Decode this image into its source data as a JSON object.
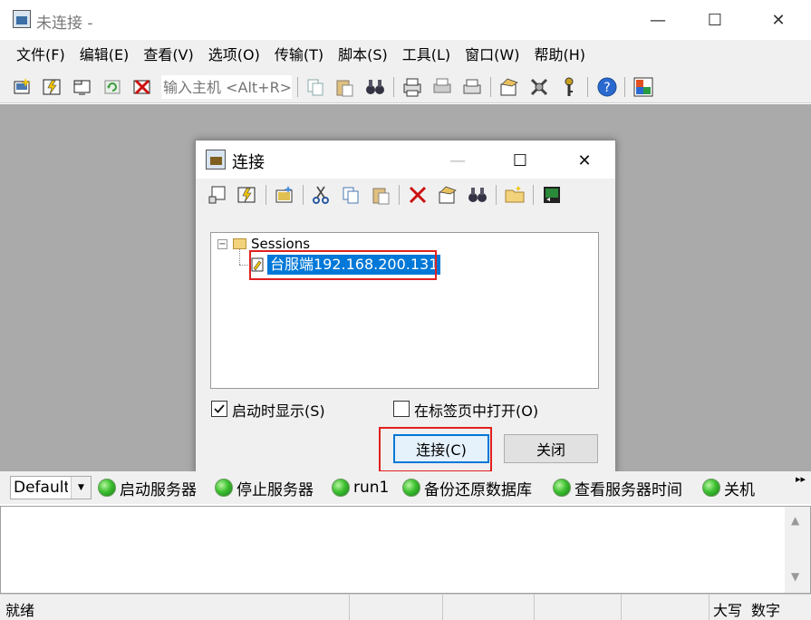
{
  "window": {
    "title": "未连接 -",
    "minimize": "—",
    "maximize": "☐",
    "close": "✕"
  },
  "menu": {
    "items": [
      "文件(F)",
      "编辑(E)",
      "查看(V)",
      "选项(O)",
      "传输(T)",
      "脚本(S)",
      "工具(L)",
      "窗口(W)",
      "帮助(H)"
    ]
  },
  "toolbar": {
    "host_placeholder": "输入主机 <Alt+R>"
  },
  "dialog": {
    "title": "连接",
    "minimize": "—",
    "maximize": "☐",
    "close": "✕",
    "tree_root": "Sessions",
    "tree_toggle": "−",
    "session": "台服端192.168.200.131",
    "show_on_startup": "启动时显示(S)",
    "show_on_startup_checked": true,
    "open_in_tab": "在标签页中打开(O)",
    "open_in_tab_checked": false,
    "connect_btn": "连接(C)",
    "close_btn": "关闭"
  },
  "buttonbar": {
    "combo_value": "Default",
    "buttons": [
      "启动服务器",
      "停止服务器",
      "run1",
      "备份还原数据库",
      "查看服务器时间",
      "关机"
    ]
  },
  "status": {
    "text": "就绪",
    "caps": "大写",
    "num": "数字"
  }
}
